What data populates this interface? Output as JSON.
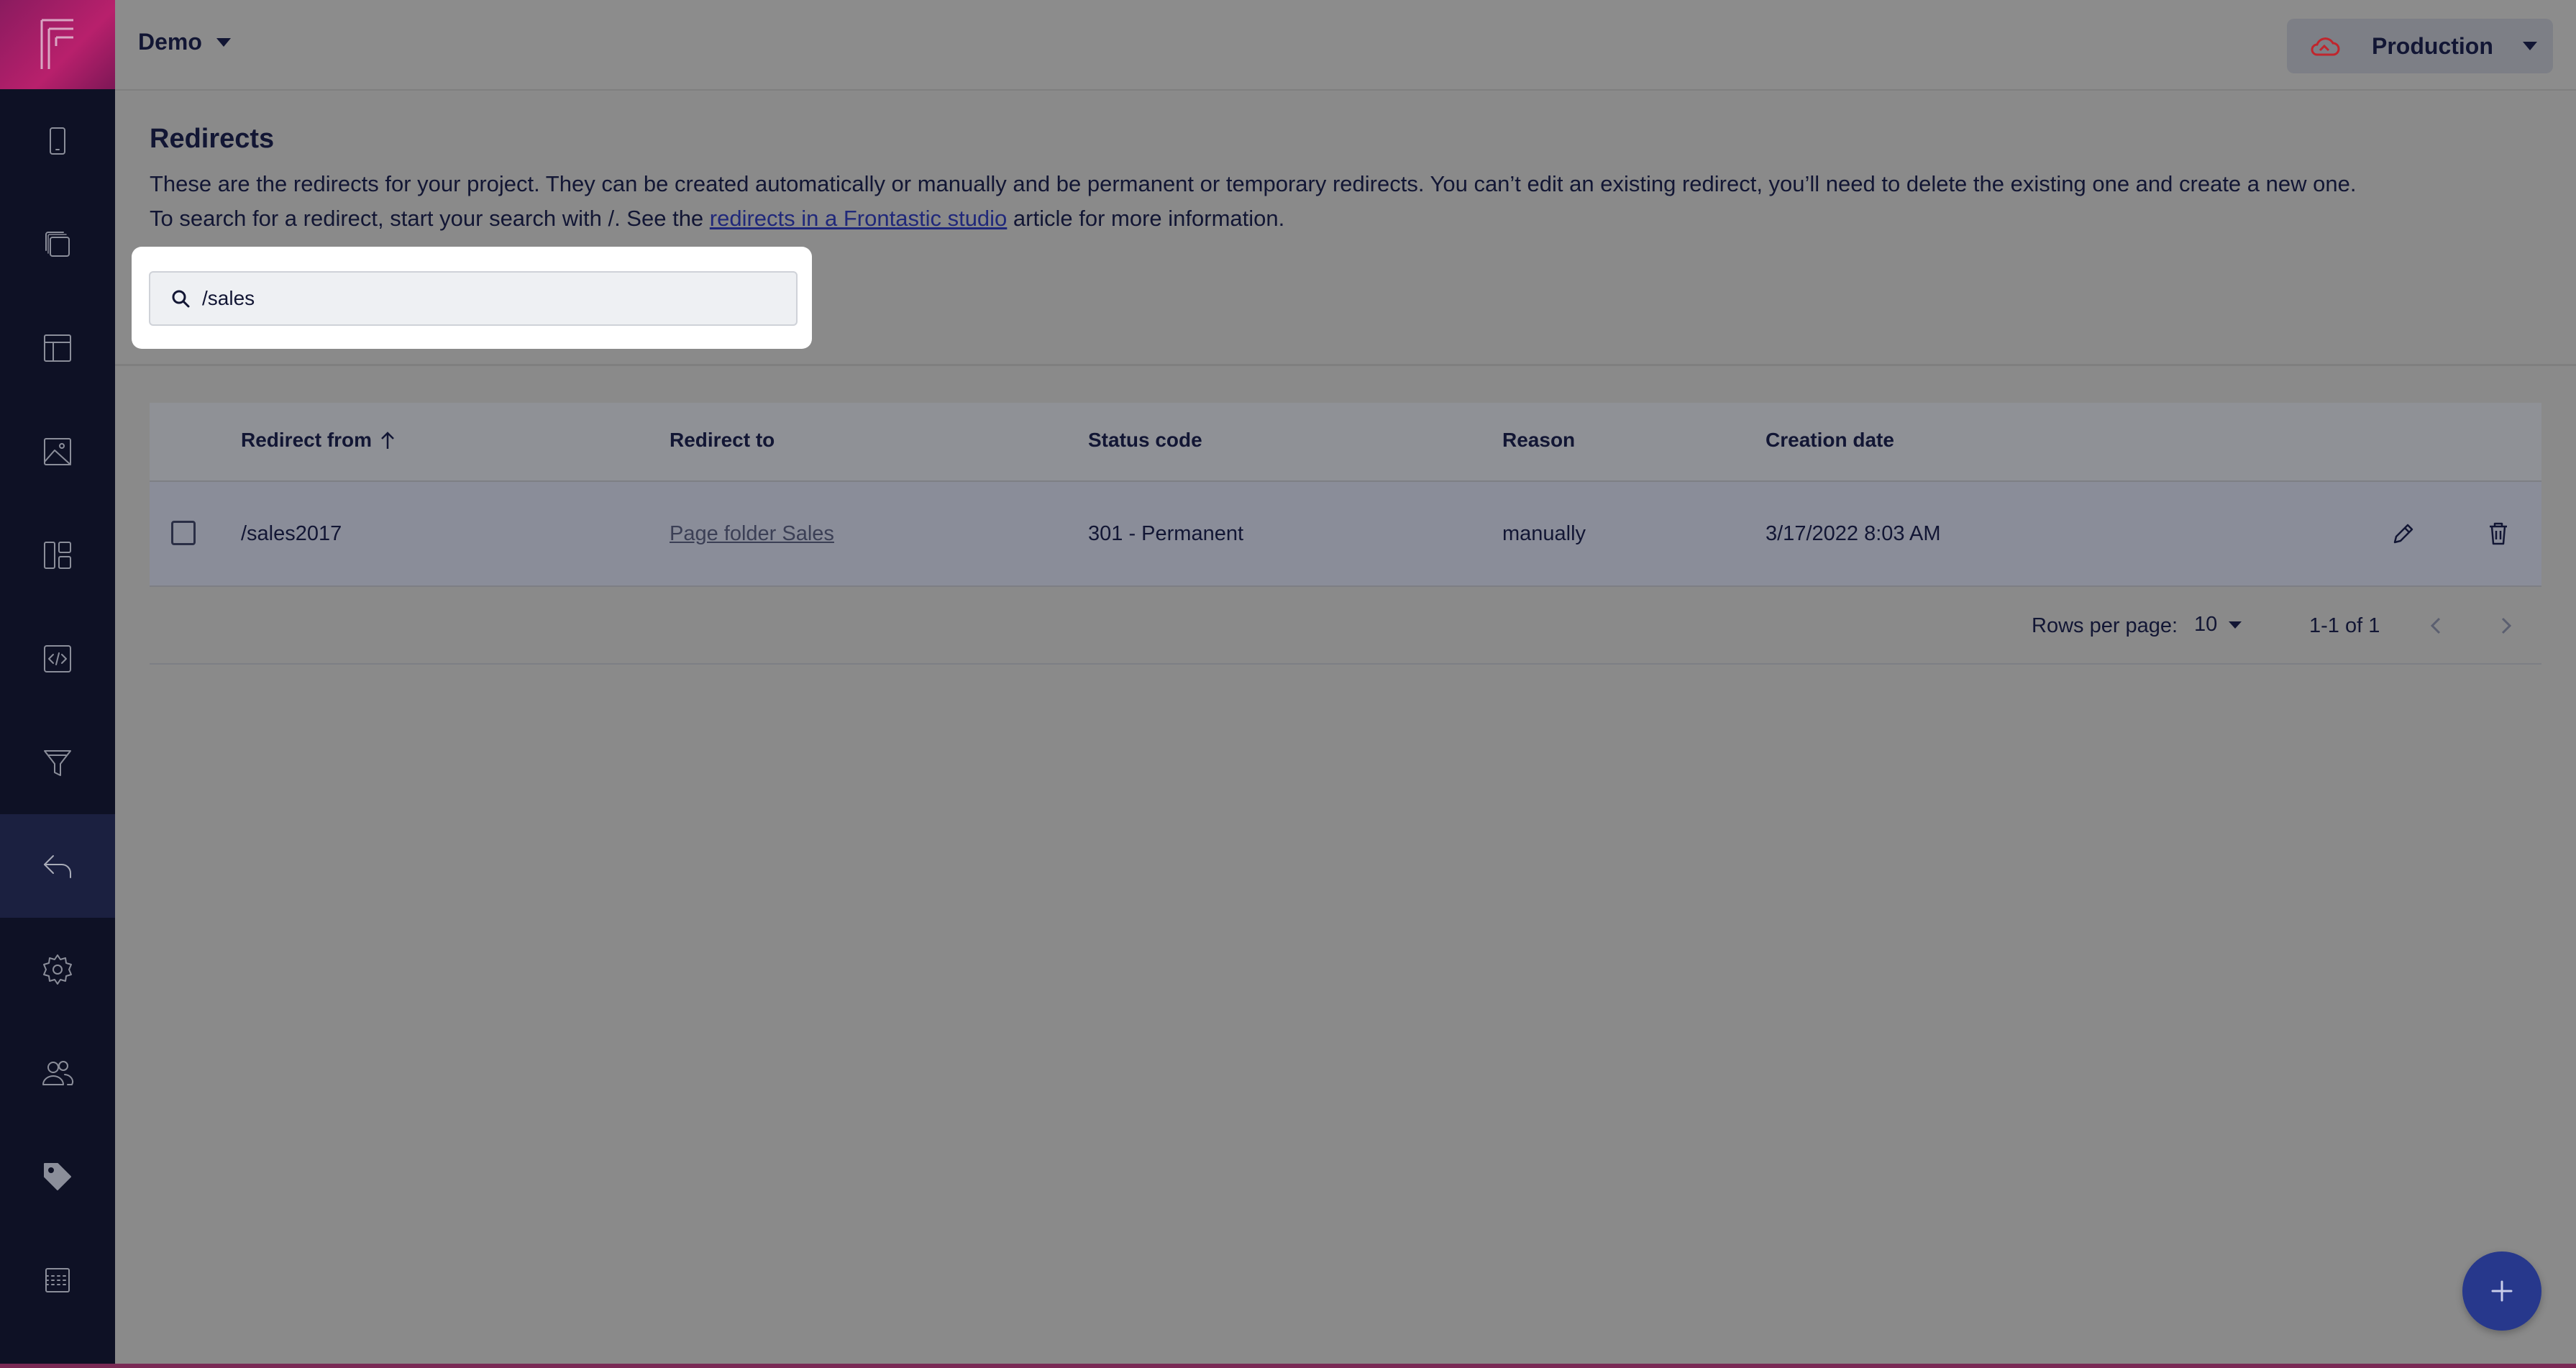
{
  "app": {
    "logo_letter": "F"
  },
  "sidebar": {
    "items": [
      {
        "icon": "mobile-icon",
        "active": false
      },
      {
        "icon": "copy-pages-icon",
        "active": false
      },
      {
        "icon": "layout-icon",
        "active": false
      },
      {
        "icon": "image-icon",
        "active": false
      },
      {
        "icon": "dashboard-icon",
        "active": false
      },
      {
        "icon": "code-icon",
        "active": false
      },
      {
        "icon": "funnel-icon",
        "active": false
      },
      {
        "icon": "reply-arrow-icon",
        "active": true
      },
      {
        "icon": "gear-icon",
        "active": false
      },
      {
        "icon": "users-icon",
        "active": false
      },
      {
        "icon": "tag-icon",
        "active": false
      },
      {
        "icon": "grid-icon",
        "active": false
      }
    ]
  },
  "header": {
    "project": "Demo",
    "environment": "Production"
  },
  "page": {
    "title": "Redirects",
    "description_line1": "These are the redirects for your project. They can be created automatically or manually and be permanent or temporary redirects. You can’t edit an existing redirect, you’ll need to delete the existing one and create a new one.",
    "description_line2_pre": "To search for a redirect, start your search with /. See the ",
    "description_link": "redirects in a Frontastic studio",
    "description_line2_post": " article for more information."
  },
  "search": {
    "value": "/sales"
  },
  "table": {
    "columns": {
      "from": "Redirect from",
      "to": "Redirect to",
      "status": "Status code",
      "reason": "Reason",
      "created": "Creation date"
    },
    "rows": [
      {
        "from": "/sales2017",
        "to": "Page folder Sales",
        "status": "301 - Permanent",
        "reason": "manually",
        "created": "3/17/2022 8:03 AM"
      }
    ],
    "footer": {
      "rows_per_page_label": "Rows per page:",
      "rows_per_page": "10",
      "range": "1-1 of 1"
    }
  },
  "colors": {
    "sidebar": "#0e1125",
    "accent_logo": "#b8206c",
    "fab": "#27388c",
    "env_cloud": "#c0262d"
  }
}
